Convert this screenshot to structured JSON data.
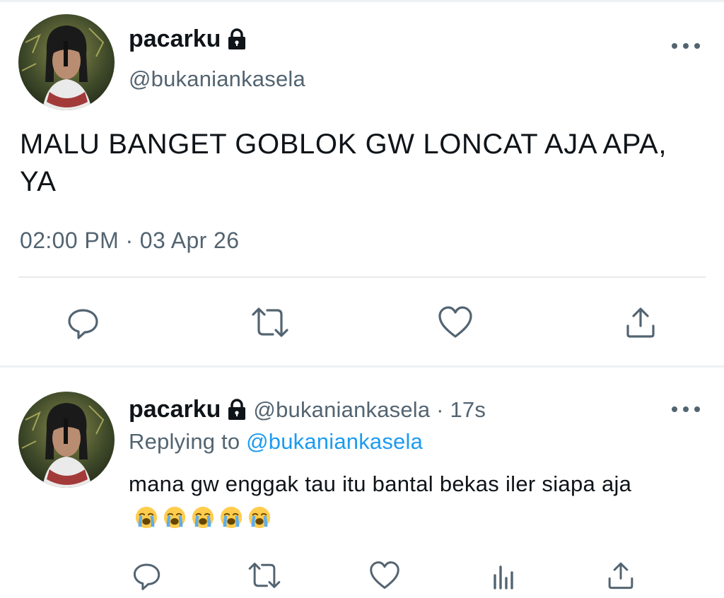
{
  "main_tweet": {
    "display_name": "pacarku",
    "handle": "@bukaniankasela",
    "text": "MALU BANGET GOBLOK GW LONCAT AJA APA, YA",
    "timestamp": "02:00 PM · 03 Apr 26",
    "actions": [
      "reply-icon",
      "retweet-icon",
      "like-icon",
      "share-icon"
    ]
  },
  "reply_tweet": {
    "display_name": "pacarku",
    "handle_time": "@bukaniankasela · 17s",
    "replying_prefix": "Replying to ",
    "replying_handle": "@bukaniankasela",
    "text": "mana gw enggak tau itu bantal bekas iler siapa aja",
    "emoji": [
      "loudly-crying-face",
      "loudly-crying-face",
      "loudly-crying-face",
      "loudly-crying-face",
      "loudly-crying-face"
    ],
    "actions": [
      "reply-icon",
      "retweet-icon",
      "like-icon",
      "analytics-icon",
      "share-icon"
    ]
  },
  "colors": {
    "text": "#0f1419",
    "secondary": "#536471",
    "link": "#1d9bf0",
    "divider": "#e7eaec"
  }
}
